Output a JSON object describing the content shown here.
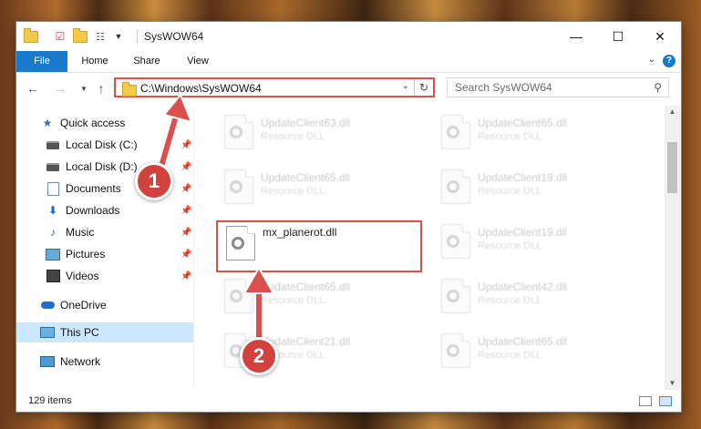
{
  "window": {
    "title": "SysWOW64",
    "controls": {
      "minimize": "—",
      "maximize": "☐",
      "close": "✕"
    }
  },
  "ribbon": {
    "tabs": [
      {
        "label": "File",
        "active": true
      },
      {
        "label": "Home"
      },
      {
        "label": "Share"
      },
      {
        "label": "View"
      }
    ],
    "help": "?"
  },
  "navigation": {
    "address": "C:\\Windows\\SysWOW64",
    "search_placeholder": "Search SysWOW64"
  },
  "sidebar": {
    "items": [
      {
        "label": "Quick access",
        "icon": "star-icon"
      },
      {
        "label": "Local Disk (C:)",
        "icon": "drive-icon",
        "pinned": true
      },
      {
        "label": "Local Disk (D:)",
        "icon": "drive-icon",
        "pinned": true
      },
      {
        "label": "Documents",
        "icon": "document-icon",
        "pinned": true
      },
      {
        "label": "Downloads",
        "icon": "download-icon",
        "pinned": true
      },
      {
        "label": "Music",
        "icon": "music-icon",
        "pinned": true
      },
      {
        "label": "Pictures",
        "icon": "pictures-icon",
        "pinned": true
      },
      {
        "label": "Videos",
        "icon": "video-icon",
        "pinned": true
      },
      {
        "label": "OneDrive",
        "icon": "cloud-icon"
      },
      {
        "label": "This PC",
        "icon": "computer-icon",
        "selected": true
      },
      {
        "label": "Network",
        "icon": "network-icon"
      }
    ]
  },
  "files": {
    "left": [
      {
        "name": "UpdateClient63.dll",
        "type": "Resource DLL"
      },
      {
        "name": "UpdateClient65.dll",
        "type": "Resource DLL"
      },
      {
        "name": "mx_planerot.dll",
        "type": ""
      },
      {
        "name": "UpdateClient65.dll",
        "type": "Resource DLL"
      },
      {
        "name": "UpdateClient21.dll",
        "type": "Resource DLL"
      }
    ],
    "right": [
      {
        "name": "UpdateClient65.dll",
        "type": "Resource DLL"
      },
      {
        "name": "UpdateClient19.dll",
        "type": "Resource DLL"
      },
      {
        "name": "UpdateClient19.dll",
        "type": "Resource DLL"
      },
      {
        "name": "UpdateClient42.dll",
        "type": "Resource DLL"
      },
      {
        "name": "UpdateClient65.dll",
        "type": "Resource DLL"
      }
    ]
  },
  "status": {
    "item_count": "129 items"
  },
  "annotations": {
    "step1": "1",
    "step2": "2"
  },
  "colors": {
    "accent": "#1979ca",
    "annotation_red": "#d9504c",
    "selected_bg": "#cce8ff"
  }
}
